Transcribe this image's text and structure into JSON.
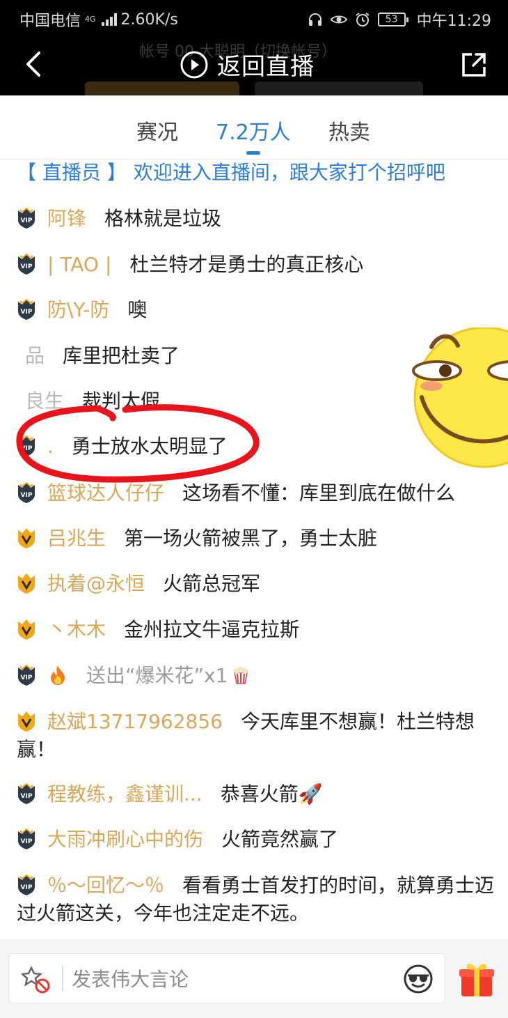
{
  "status_bar": {
    "carrier": "中国电信",
    "network": "4G",
    "speed": "2.60K/s",
    "battery": "53",
    "time": "中午11:29"
  },
  "header": {
    "title": "返回直播",
    "background_hint": "帐号 00 大聪明（切换帐号）"
  },
  "tabs": [
    {
      "label": "赛况",
      "active": false
    },
    {
      "label": "7.2万人",
      "active": true
    },
    {
      "label": "热卖",
      "active": false
    }
  ],
  "messages": [
    {
      "type": "system",
      "tag": "【 直播员 】",
      "text": "欢迎进入直播间，跟大家打个招呼吧"
    },
    {
      "type": "vip",
      "nick": "阿锋",
      "text": "格林就是垃圾"
    },
    {
      "type": "vip",
      "nick": "| TAO |",
      "text": "杜兰特才是勇士的真正核心"
    },
    {
      "type": "vip",
      "nick": "防\\Y-防",
      "text": "噢"
    },
    {
      "type": "plain",
      "nick": "品",
      "text": "库里把杜卖了"
    },
    {
      "type": "plain",
      "nick": "良生",
      "text": "裁判太假"
    },
    {
      "type": "vip",
      "nick": ".",
      "text": "勇士放水太明显了"
    },
    {
      "type": "vip",
      "nick": "篮球达人仔仔",
      "text": "这场看不懂：库里到底在做什么"
    },
    {
      "type": "v",
      "nick": "吕兆生",
      "text": "第一场火箭被黑了，勇士太脏"
    },
    {
      "type": "v",
      "nick": "执着@永恒",
      "text": "火箭总冠军"
    },
    {
      "type": "v",
      "nick": "丶木木",
      "text": "金州拉文牛逼克拉斯"
    },
    {
      "type": "gift",
      "text": "送出“爆米花”x1"
    },
    {
      "type": "v",
      "nick": "赵斌13717962856",
      "text": "今天库里不想赢！杜兰特想赢！"
    },
    {
      "type": "vip",
      "nick": "程教练，鑫谨训...",
      "text": "恭喜火箭🚀"
    },
    {
      "type": "vip",
      "nick": "大雨冲刷心中的伤",
      "text": "火箭竟然赢了"
    },
    {
      "type": "vip",
      "nick": "％～回忆～％",
      "text": "看看勇士首发打的时间，就算勇士迈过火箭这关，今年也注定走不远。"
    }
  ],
  "input": {
    "placeholder": "发表伟大言论"
  },
  "colors": {
    "accent": "#2e7ed8",
    "nick": "#d8a85a",
    "vip_badge": "#2f3a48",
    "v_badge": "#f0a81a",
    "annotation": "#e8141c"
  }
}
